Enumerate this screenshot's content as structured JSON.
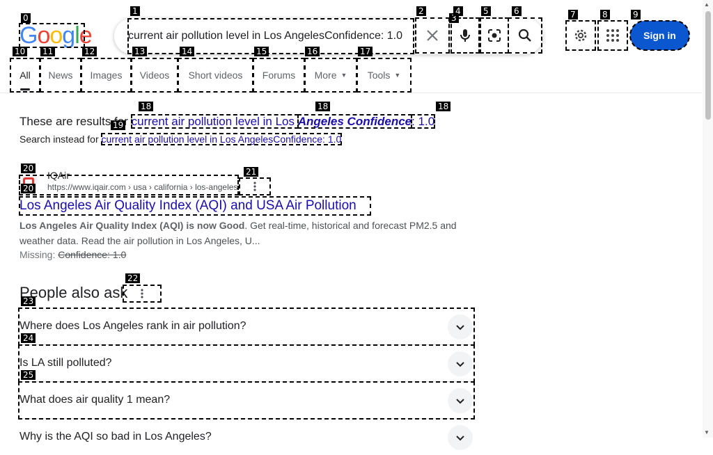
{
  "logo": {
    "text": "Google",
    "letters": [
      "G",
      "o",
      "o",
      "g",
      "l",
      "e"
    ],
    "colors": [
      "#4285f4",
      "#ea4335",
      "#fbbc05",
      "#4285f4",
      "#34a853",
      "#ea4335"
    ]
  },
  "search": {
    "query": "current air pollution level in Los AngelesConfidence: 1.0",
    "placeholder": ""
  },
  "header": {
    "signin_label": "Sign in"
  },
  "tabs": [
    {
      "label": "All"
    },
    {
      "label": "News"
    },
    {
      "label": "Images"
    },
    {
      "label": "Videos"
    },
    {
      "label": "Short videos"
    },
    {
      "label": "Forums"
    },
    {
      "label": "More"
    },
    {
      "label": "Tools"
    }
  ],
  "correction": {
    "prefix": "These are results for ",
    "part1": "current air pollution level in Los ",
    "part2": "Angeles Confidence",
    "part3": ": 1.0",
    "instead_prefix": "Search instead for ",
    "instead_link": "current air pollution level in Los AngelesConfidence: 1.0"
  },
  "result": {
    "site_name": "IQAir",
    "url": "https://www.iqair.com › usa › california › los-angeles",
    "title": "Los Angeles Air Quality Index (AQI) and USA Air Pollution",
    "snippet_bold": "Los Angeles Air Quality Index (AQI) is now Good",
    "snippet_rest": ". Get real-time, historical and forecast PM2.5 and weather data. Read the air pollution in Los Angeles, U...",
    "missing_label": "Missing: ",
    "missing_terms": "Confidence: 1.0"
  },
  "paa": {
    "heading": "People also ask",
    "questions": [
      "Where does Los Angeles rank in air pollution?",
      "Is LA still polluted?",
      "What does air quality 1 mean?",
      "Why is the AQI so bad in Los Angeles?"
    ]
  },
  "marks": [
    "0",
    "1",
    "2",
    "3",
    "4",
    "5",
    "6",
    "7",
    "8",
    "9",
    "10",
    "11",
    "12",
    "13",
    "14",
    "15",
    "16",
    "17",
    "18",
    "19",
    "20",
    "21",
    "22",
    "23",
    "24",
    "25"
  ],
  "colors": {
    "accent": "#0b57d0",
    "link": "#1a0dab"
  }
}
